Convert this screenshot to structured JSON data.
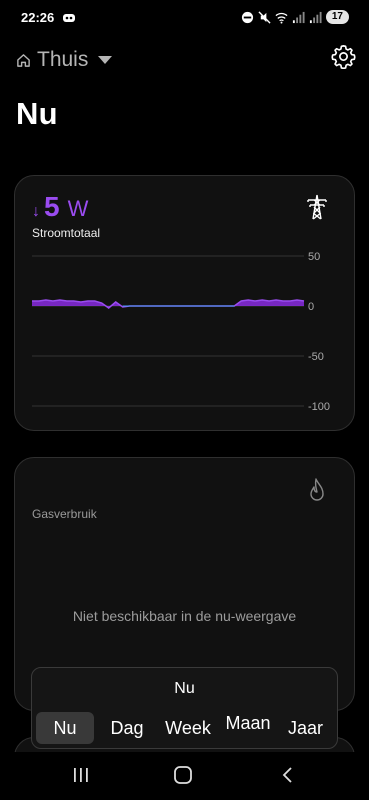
{
  "status_bar": {
    "time": "22:26",
    "battery": "17",
    "icons": [
      "notification-icon",
      "dnd-icon",
      "mute-icon",
      "wifi-icon",
      "signal-icon",
      "signal-icon",
      "battery-icon"
    ]
  },
  "header": {
    "home_label": "Thuis",
    "page_title": "Nu"
  },
  "power_card": {
    "value": "5",
    "unit": "W",
    "label": "Stroomtotaal",
    "accent": "#8a2be2"
  },
  "chart_data": {
    "type": "area",
    "x_label": "",
    "y_label": "",
    "ylim": [
      -100,
      50
    ],
    "ytick_labels": [
      "50",
      "0",
      "-50",
      "-100"
    ],
    "grid": true,
    "series": [
      {
        "values": [
          5,
          5,
          6,
          5,
          6,
          5,
          5,
          4,
          5,
          5,
          3,
          -2,
          4,
          -1,
          0,
          0,
          0,
          0,
          0,
          0,
          0,
          0,
          0,
          0,
          0,
          0,
          0,
          0,
          0,
          0,
          5,
          6,
          5,
          6,
          5,
          6,
          5,
          5,
          6,
          5
        ]
      }
    ]
  },
  "gas_card": {
    "label": "Gasverbruik",
    "unavailable_text": "Niet beschikbaar in de nu-weergave"
  },
  "period_selector": {
    "current": "Nu",
    "tabs": [
      {
        "label": "Nu",
        "active": true
      },
      {
        "label": "Dag",
        "active": false
      },
      {
        "label": "Week",
        "active": false
      },
      {
        "label": "Maan",
        "active": false
      },
      {
        "label": "Jaar",
        "active": false
      }
    ]
  }
}
